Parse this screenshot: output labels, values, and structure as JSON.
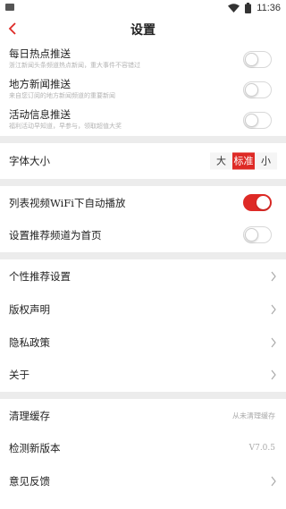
{
  "status": {
    "time": "11:36"
  },
  "header": {
    "title": "设置"
  },
  "push": [
    {
      "title": "每日热点推送",
      "desc": "浙江新闻头条频道热点新闻，重大事件不容错过",
      "on": false
    },
    {
      "title": "地方新闻推送",
      "desc": "来自您订阅的地方新闻频道的重要新闻",
      "on": false
    },
    {
      "title": "活动信息推送",
      "desc": "福利活动早知道，早参与，领取超值大奖",
      "on": false
    }
  ],
  "font_size": {
    "label": "字体大小",
    "options": [
      "大",
      "标准",
      "小"
    ],
    "selected": "标准"
  },
  "video": {
    "autoplay_label": "列表视频WiFi下自动播放",
    "autoplay_on": true,
    "home_label": "设置推荐频道为首页",
    "home_on": false
  },
  "links": [
    "个性推荐设置",
    "版权声明",
    "隐私政策",
    "关于"
  ],
  "cache": {
    "label": "清理缓存",
    "value": "从未清理缓存"
  },
  "version": {
    "label": "检测新版本",
    "value": "V7.0.5"
  },
  "feedback": {
    "label": "意见反馈"
  },
  "colors": {
    "accent": "#de2a26",
    "separator": "#ececec"
  }
}
